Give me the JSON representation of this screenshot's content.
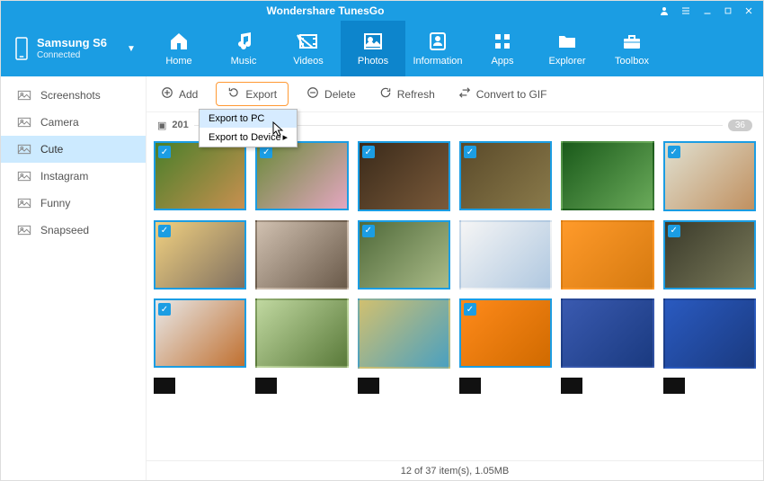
{
  "title": "Wondershare TunesGo",
  "device": {
    "name": "Samsung S6",
    "status": "Connected"
  },
  "tabs": [
    {
      "id": "home",
      "label": "Home"
    },
    {
      "id": "music",
      "label": "Music"
    },
    {
      "id": "videos",
      "label": "Videos"
    },
    {
      "id": "photos",
      "label": "Photos",
      "active": true
    },
    {
      "id": "information",
      "label": "Information"
    },
    {
      "id": "apps",
      "label": "Apps"
    },
    {
      "id": "explorer",
      "label": "Explorer"
    },
    {
      "id": "toolbox",
      "label": "Toolbox"
    }
  ],
  "sidebar": [
    {
      "id": "screenshots",
      "label": "Screenshots"
    },
    {
      "id": "camera",
      "label": "Camera"
    },
    {
      "id": "cute",
      "label": "Cute",
      "active": true
    },
    {
      "id": "instagram",
      "label": "Instagram"
    },
    {
      "id": "funny",
      "label": "Funny"
    },
    {
      "id": "snapseed",
      "label": "Snapseed"
    }
  ],
  "toolbar": {
    "add": "Add",
    "export": "Export",
    "delete": "Delete",
    "refresh": "Refresh",
    "togif": "Convert to GIF"
  },
  "exportMenu": {
    "toPC": "Export to PC",
    "toDevice": "Export to Device"
  },
  "group": {
    "year": "201",
    "count": "36"
  },
  "thumbs": [
    {
      "sel": true,
      "c1": "#4a7f2a",
      "c2": "#c89050"
    },
    {
      "sel": true,
      "c1": "#6a8a3a",
      "c2": "#e4a6c0"
    },
    {
      "sel": true,
      "c1": "#3a2a1a",
      "c2": "#7a5a3a"
    },
    {
      "sel": true,
      "c1": "#5a4a2a",
      "c2": "#8a7a4a"
    },
    {
      "sel": false,
      "c1": "#1a5a1a",
      "c2": "#6aaa5a"
    },
    {
      "sel": true,
      "c1": "#e0e0d0",
      "c2": "#c09060"
    },
    {
      "sel": true,
      "c1": "#f0d080",
      "c2": "#807060"
    },
    {
      "sel": false,
      "c1": "#d0c0b0",
      "c2": "#6a5a4a"
    },
    {
      "sel": true,
      "c1": "#506a3a",
      "c2": "#aabb88"
    },
    {
      "sel": false,
      "c1": "#f5f5f5",
      "c2": "#b0c8e0"
    },
    {
      "sel": false,
      "c1": "#ff9a2a",
      "c2": "#d67a10"
    },
    {
      "sel": true,
      "c1": "#3a3a2a",
      "c2": "#7a7a5a"
    },
    {
      "sel": true,
      "c1": "#e8e8e8",
      "c2": "#c07030"
    },
    {
      "sel": false,
      "c1": "#c0d8a0",
      "c2": "#5a7a3a"
    },
    {
      "sel": false,
      "c1": "#d0c070",
      "c2": "#4aa0c0"
    },
    {
      "sel": true,
      "c1": "#ff8a1a",
      "c2": "#d06a00"
    },
    {
      "sel": false,
      "c1": "#3a5ab0",
      "c2": "#1a3a80"
    },
    {
      "sel": false,
      "c1": "#2a5ac0",
      "c2": "#1a3a80"
    }
  ],
  "statusbar": "12 of 37 item(s), 1.05MB"
}
